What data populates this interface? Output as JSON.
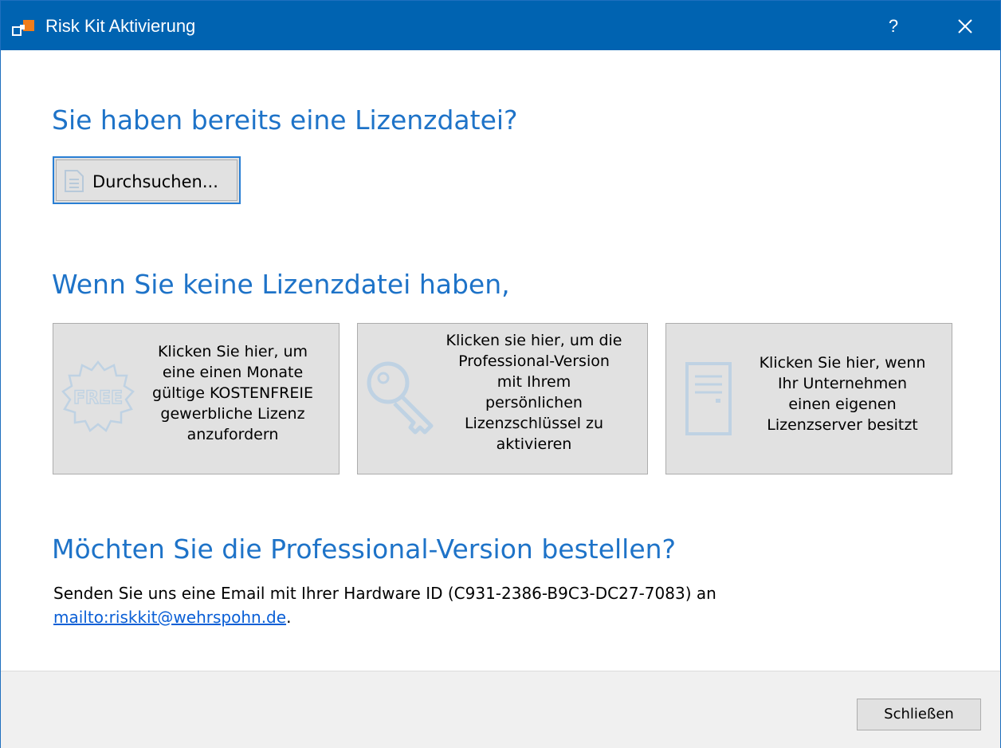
{
  "window": {
    "title": "Risk Kit Aktivierung",
    "help_label": "?",
    "accent_color": "#0063b1",
    "icons": [
      "app-icon",
      "help-icon",
      "close-icon"
    ]
  },
  "license_file": {
    "heading": "Sie haben bereits eine Lizenzdatei?",
    "browse_label": "Durchsuchen...",
    "browse_icon": "document-icon"
  },
  "no_license": {
    "heading": "Wenn Sie keine Lizenzdatei haben,",
    "tiles": [
      {
        "icon": "free-badge-icon",
        "badge_text": "FREE",
        "lines": [
          "Klicken Sie hier, um",
          "eine einen Monate",
          "gültige KOSTENFREIE",
          "gewerbliche Lizenz",
          "anzufordern"
        ]
      },
      {
        "icon": "key-icon",
        "lines": [
          "Klicken sie hier, um die",
          "Professional-Version",
          "mit Ihrem",
          "persönlichen",
          "Lizenzschlüssel zu",
          "aktivieren"
        ]
      },
      {
        "icon": "server-icon",
        "lines": [
          "Klicken Sie hier, wenn",
          "Ihr Unternehmen",
          "einen eigenen",
          "Lizenzserver besitzt"
        ]
      }
    ]
  },
  "order": {
    "heading": "Möchten Sie die Professional-Version bestellen?",
    "text": "Senden Sie uns eine Email mit Ihrer Hardware ID (C931-2386-B9C3-DC27-7083) an",
    "link": "mailto:riskkit@wehrspohn.de",
    "suffix": "."
  },
  "footer": {
    "close_label": "Schließen"
  }
}
